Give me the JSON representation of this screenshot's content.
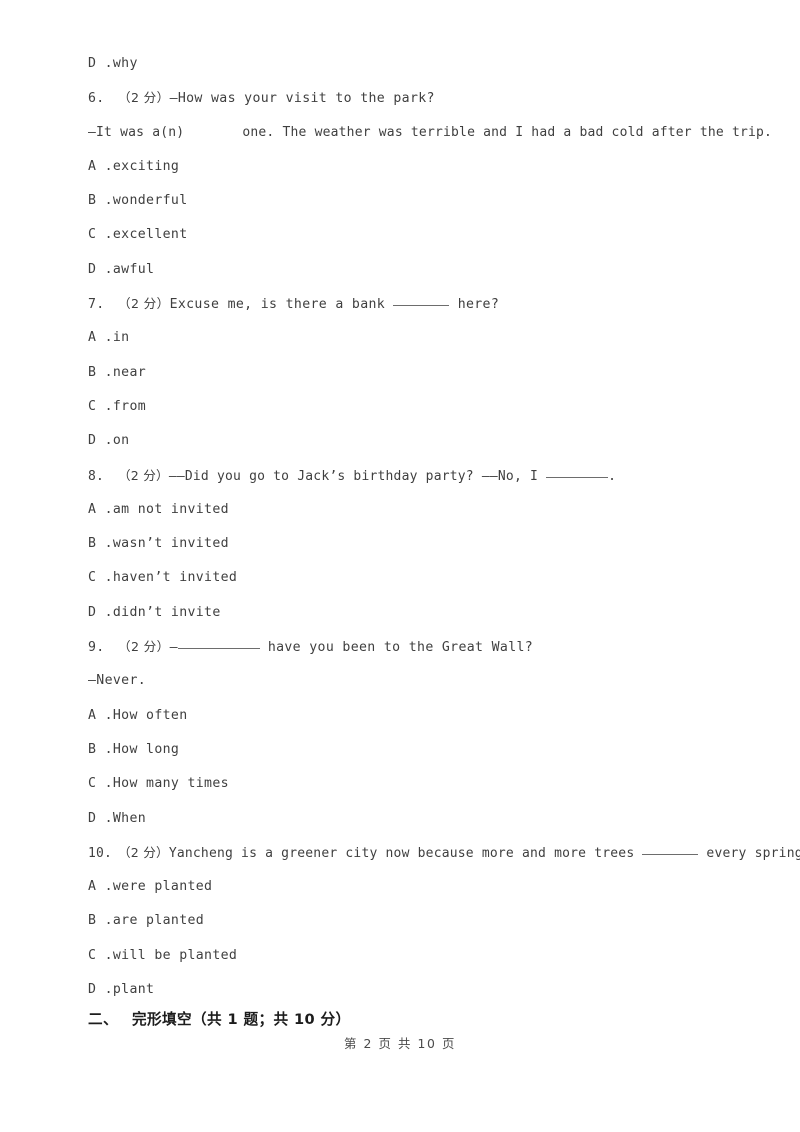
{
  "document": {
    "page_label": "第 2 页 共 10 页",
    "section_heading_number": "二、",
    "section_heading_title": "完形填空（共 1 题；共 10 分）"
  },
  "lines": [
    {
      "id": "l0",
      "type": "option",
      "letter": "D .",
      "text": "why"
    },
    {
      "id": "l1",
      "type": "question",
      "num": "6.",
      "score": "（2 分）",
      "text": "—How was your visit to the park?"
    },
    {
      "id": "l2",
      "type": "cont",
      "pre": "—It was a(n)",
      "blank": "none",
      "post": "one. The weather was terrible and I had a bad cold after the trip."
    },
    {
      "id": "l3",
      "type": "option",
      "letter": "A .",
      "text": "exciting"
    },
    {
      "id": "l4",
      "type": "option",
      "letter": "B .",
      "text": "wonderful"
    },
    {
      "id": "l5",
      "type": "option",
      "letter": "C .",
      "text": "excellent"
    },
    {
      "id": "l6",
      "type": "option",
      "letter": "D .",
      "text": "awful"
    },
    {
      "id": "l7",
      "type": "question_blank",
      "num": "7.",
      "score": "（2 分）",
      "pre": "Excuse me, is there a bank",
      "blank": "sm",
      "post": "here?"
    },
    {
      "id": "l8",
      "type": "option",
      "letter": "A .",
      "text": "in"
    },
    {
      "id": "l9",
      "type": "option",
      "letter": "B .",
      "text": "near"
    },
    {
      "id": "l10",
      "type": "option",
      "letter": "C .",
      "text": "from"
    },
    {
      "id": "l11",
      "type": "option",
      "letter": "D .",
      "text": "on"
    },
    {
      "id": "l12",
      "type": "question_blank",
      "num": "8.",
      "score": "（2 分）",
      "pre": "——Did you go to Jack’s birthday party? ——No, I",
      "blank": "md",
      "post": "."
    },
    {
      "id": "l13",
      "type": "option",
      "letter": "A .",
      "text": "am not invited"
    },
    {
      "id": "l14",
      "type": "option",
      "letter": "B .",
      "text": "wasn’t invited"
    },
    {
      "id": "l15",
      "type": "option",
      "letter": "C .",
      "text": "haven’t invited"
    },
    {
      "id": "l16",
      "type": "option",
      "letter": "D .",
      "text": "didn’t invite"
    },
    {
      "id": "l17",
      "type": "question_blank",
      "num": "9.",
      "score": "（2 分）",
      "pre": "—",
      "blank": "lg",
      "post": "have you been to the Great Wall?"
    },
    {
      "id": "l18",
      "type": "cont_plain",
      "text": "—Never."
    },
    {
      "id": "l19",
      "type": "option",
      "letter": "A .",
      "text": "How often"
    },
    {
      "id": "l20",
      "type": "option",
      "letter": "B .",
      "text": "How long"
    },
    {
      "id": "l21",
      "type": "option",
      "letter": "C .",
      "text": "How many times"
    },
    {
      "id": "l22",
      "type": "option",
      "letter": "D .",
      "text": "When"
    },
    {
      "id": "l23",
      "type": "question_blank",
      "num": "10.",
      "score": "（2 分）",
      "pre": "Yancheng is a greener city now because more and more trees",
      "blank": "sm",
      "post": "every spring."
    },
    {
      "id": "l24",
      "type": "option",
      "letter": "A .",
      "text": "were planted"
    },
    {
      "id": "l25",
      "type": "option",
      "letter": "B .",
      "text": "are planted"
    },
    {
      "id": "l26",
      "type": "option",
      "letter": "C .",
      "text": "will be planted"
    },
    {
      "id": "l27",
      "type": "option",
      "letter": "D .",
      "text": "plant"
    }
  ]
}
